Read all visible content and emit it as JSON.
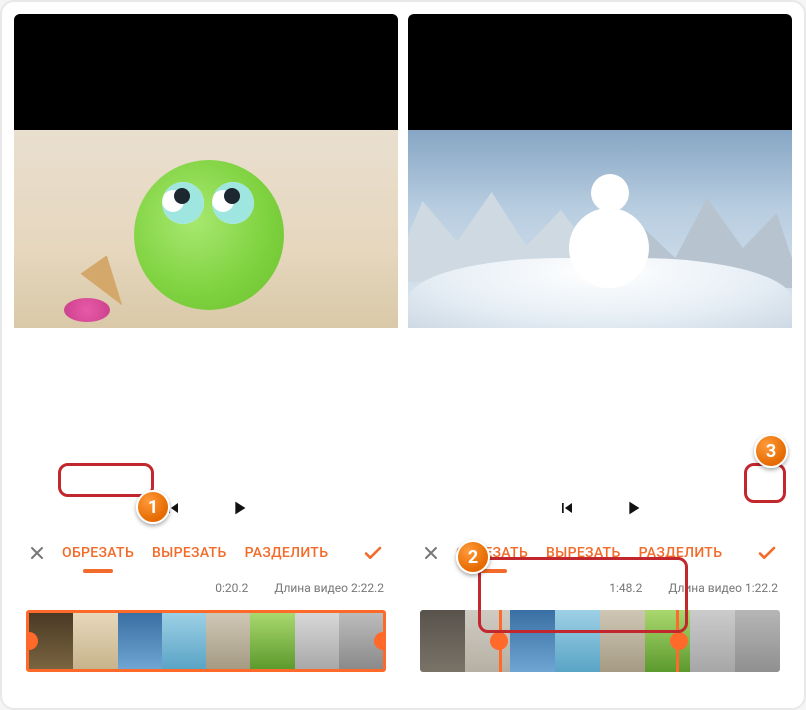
{
  "left": {
    "tabs": {
      "trim": "ОБРЕЗАТЬ",
      "cut": "ВЫРЕЗАТЬ",
      "split": "РАЗДЕЛИТЬ"
    },
    "active_tab": "trim",
    "playhead_time": "0:20.2",
    "duration_label": "Длина видео 2:22.2"
  },
  "right": {
    "tabs": {
      "trim": "ОБРЕЗАТЬ",
      "cut": "ВЫРЕЗАТЬ",
      "split": "РАЗДЕЛИТЬ"
    },
    "active_tab": "trim",
    "playhead_time": "1:48.2",
    "duration_label": "Длина видео 1:22.2"
  },
  "annotations": {
    "b1": "1",
    "b2": "2",
    "b3": "3"
  },
  "colors": {
    "accent": "#f36b2a",
    "callout": "#c1272d"
  }
}
